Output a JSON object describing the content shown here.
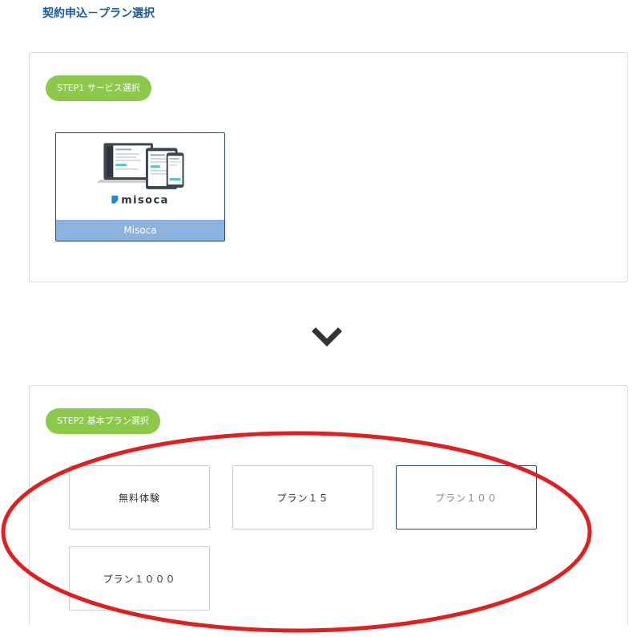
{
  "page_title": "契約申込－プラン選択",
  "step1": {
    "label": "STEP1 サービス選択",
    "service": {
      "name": "Misoca",
      "logo_text": "misoca",
      "selected": true
    }
  },
  "step2": {
    "label": "STEP2 基本プラン選択",
    "plans": [
      {
        "label": "無料体験",
        "selected": false
      },
      {
        "label": "プラン１５",
        "selected": false
      },
      {
        "label": "プラン１００",
        "selected": true
      },
      {
        "label": "プラン１０００",
        "selected": false
      }
    ]
  },
  "icons": {
    "step_arrow": "chevron-down-icon",
    "logo_mark": "misoca-logo-icon"
  },
  "colors": {
    "title": "#1a5c9e",
    "step_pill": "#8cc94b",
    "service_label_bg": "#8eb2e0",
    "selected_border": "#23486b",
    "annotation": "#e02020"
  }
}
